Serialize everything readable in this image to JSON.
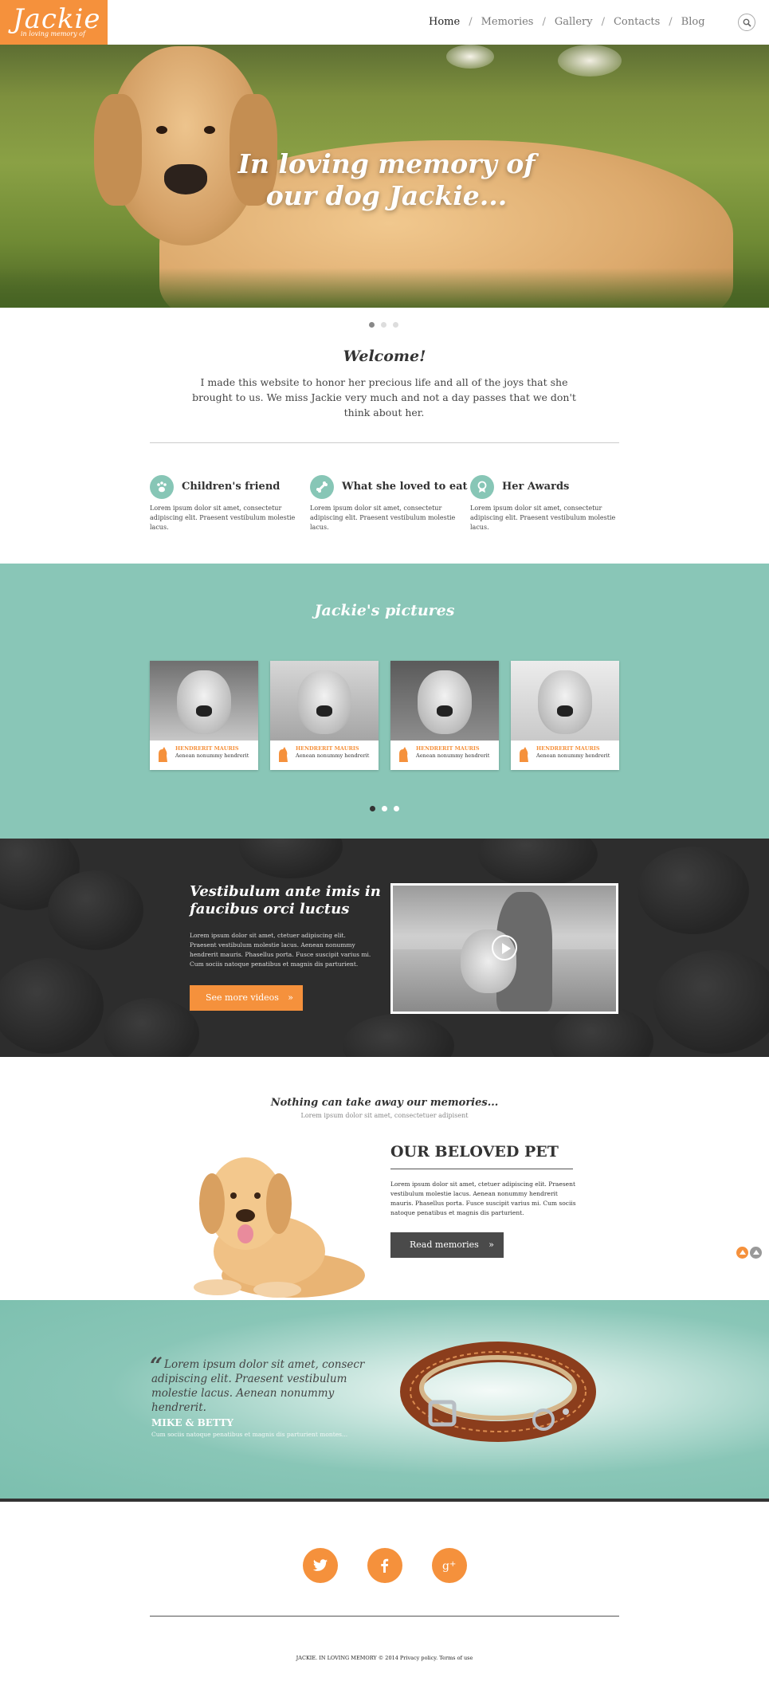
{
  "brand": {
    "logo": "Jackie",
    "logo_tagline": "in loving memory of",
    "accent": "#f5913c",
    "teal": "#89c6b7"
  },
  "nav": {
    "items": [
      "Home",
      "Memories",
      "Gallery",
      "Contacts",
      "Blog"
    ],
    "active": "Home",
    "separator": "/",
    "search_icon": "search-icon"
  },
  "hero": {
    "title_line1": "In loving memory of",
    "title_line2": "our dog Jackie..."
  },
  "welcome": {
    "title": "Welcome!",
    "text": "I made this website to honor her precious life and all of the joys that she brought to us. We miss Jackie very much and not a day passes that we don't think about her."
  },
  "features": [
    {
      "icon": "paw-icon",
      "title": "Children's friend",
      "text": "Lorem ipsum dolor sit amet, consectetur adipiscing elit. Praesent vestibulum molestie lacus."
    },
    {
      "icon": "bone-icon",
      "title": "What she loved to eat",
      "text": "Lorem ipsum dolor sit amet, consectetur adipiscing elit. Praesent vestibulum molestie lacus."
    },
    {
      "icon": "award-icon",
      "title": "Her Awards",
      "text": "Lorem ipsum dolor sit amet, consectetur adipiscing elit. Praesent vestibulum molestie lacus."
    }
  ],
  "pictures": {
    "title": "Jackie's pictures",
    "cards": [
      {
        "name": "HENDRERIT MAURIS",
        "sub": "Aenean nonummy hendrerit"
      },
      {
        "name": "HENDRERIT MAURIS",
        "sub": "Aenean nonummy hendrerit"
      },
      {
        "name": "HENDRERIT MAURIS",
        "sub": "Aenean nonummy hendrerit"
      },
      {
        "name": "HENDRERIT MAURIS",
        "sub": "Aenean nonummy hendrerit"
      }
    ]
  },
  "video": {
    "title": "Vestibulum ante imis in faucibus orci luctus",
    "text": "Lorem ipsum dolor sit amet, ctetuer adipiscing elit. Praesent vestibulum molestie lacus. Aenean nonummy hendrerit mauris. Phasellus porta. Fusce suscipit varius mi. Cum sociis natoque penatibus et magnis dis parturient.",
    "button": "See more videos",
    "button_arrow": "»"
  },
  "memories": {
    "title": "Nothing can take away our memories...",
    "subtitle": "Lorem ipsum dolor sit amet, consectetuer adipisent",
    "heading": "OUR BELOVED PET",
    "text": "Lorem ipsum dolor sit amet, ctetuer adipiscing elit. Praesent vestibulum molestie lacus. Aenean nonummy hendrerit mauris. Phasellus porta. Fusce suscipit varius mi. Cum sociis natoque penatibus et magnis dis parturient.",
    "button": "Read memories",
    "button_arrow": "»"
  },
  "testimonial": {
    "quote_mark": "“",
    "quote": "Lorem ipsum dolor sit amet, consecr adipiscing elit. Praesent vestibulum molestie lacus. Aenean nonummy hendrerit.",
    "author": "MIKE & BETTY",
    "author_sub": "Cum sociis natoque penatibus et magnis dis parturient montes..."
  },
  "social": [
    "twitter-icon",
    "facebook-icon",
    "google-plus-icon"
  ],
  "footer": {
    "text": "JACKIE. IN LOVING MEMORY © 2014 Privacy policy. Terms of use"
  }
}
